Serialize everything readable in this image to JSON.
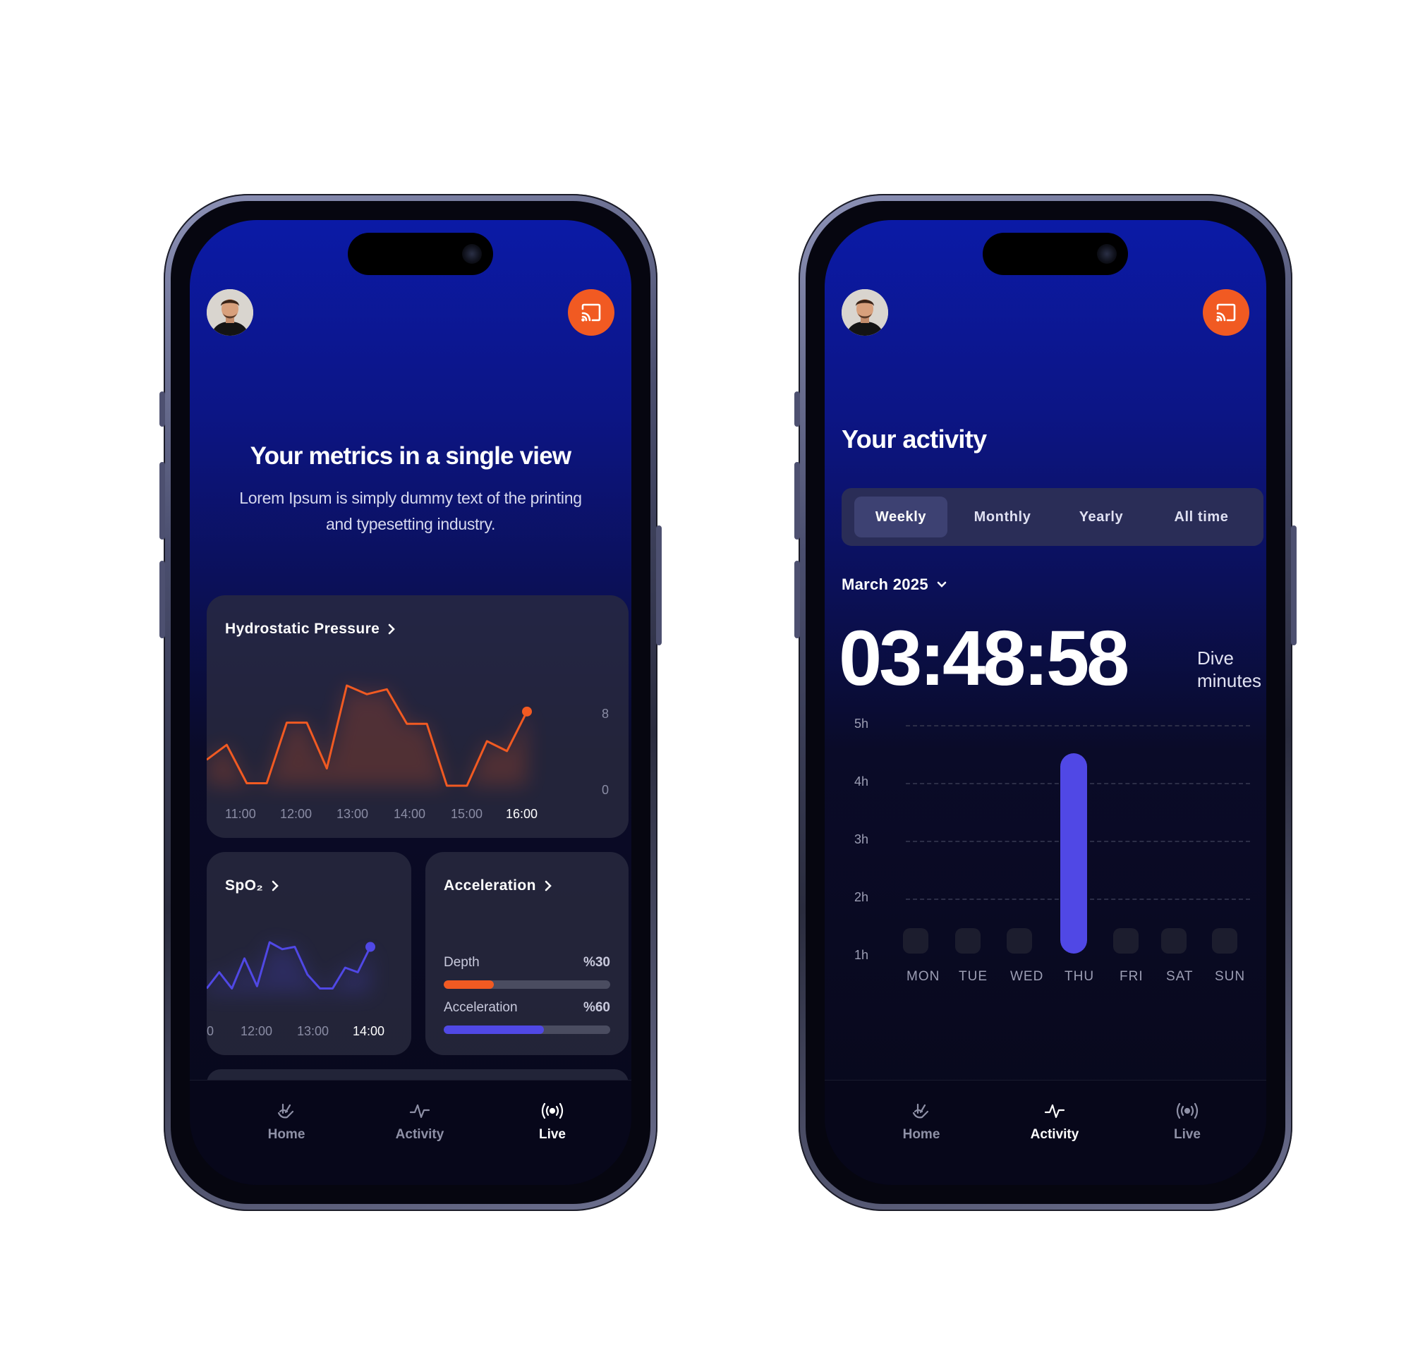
{
  "colors": {
    "accent_orange": "#f15a22",
    "accent_purple": "#5048e5",
    "screen_top": "#0b1aa6",
    "screen_bottom": "#08081a"
  },
  "phone1": {
    "hero": {
      "title": "Your metrics in a single view",
      "subtitle": "Lorem Ipsum is simply dummy text of the printing and typesetting industry."
    },
    "pressure_card": {
      "title": "Hydrostatic Pressure",
      "y_ticks": [
        "8",
        "0"
      ],
      "x_ticks": [
        "11:00",
        "12:00",
        "13:00",
        "14:00",
        "15:00",
        "16:00"
      ]
    },
    "spo2_card": {
      "title": "SpO₂",
      "x_ticks": [
        "0",
        "12:00",
        "13:00",
        "14:00"
      ]
    },
    "accel_card": {
      "title": "Acceleration",
      "rows": [
        {
          "label": "Depth",
          "value": "%30",
          "fraction": 0.3,
          "color": "#f15a22"
        },
        {
          "label": "Acceleration",
          "value": "%60",
          "fraction": 0.6,
          "color": "#5048e5"
        }
      ]
    },
    "nav": [
      {
        "label": "Home",
        "icon": "home-hand-icon",
        "active": false
      },
      {
        "label": "Activity",
        "icon": "activity-pulse-icon",
        "active": false
      },
      {
        "label": "Live",
        "icon": "live-broadcast-icon",
        "active": true
      }
    ]
  },
  "phone2": {
    "title": "Your activity",
    "tabs": [
      {
        "label": "Weekly",
        "active": true
      },
      {
        "label": "Monthly",
        "active": false
      },
      {
        "label": "Yearly",
        "active": false
      },
      {
        "label": "All time",
        "active": false
      }
    ],
    "month": "March 2025",
    "timer": "03:48:58",
    "timer_unit_line1": "Dive",
    "timer_unit_line2": "minutes",
    "nav": [
      {
        "label": "Home",
        "icon": "home-hand-icon",
        "active": false
      },
      {
        "label": "Activity",
        "icon": "activity-pulse-icon",
        "active": true
      },
      {
        "label": "Live",
        "icon": "live-broadcast-icon",
        "active": false
      }
    ]
  },
  "chart_data": [
    {
      "type": "line",
      "x_ticks": [
        "11:00",
        "12:00",
        "13:00",
        "14:00",
        "15:00",
        "16:00"
      ],
      "ylim": [
        0,
        8
      ],
      "y_ticks": [
        "0",
        "8"
      ],
      "series": [
        {
          "values": [
            2.1,
            3.3,
            0.2,
            0.2,
            5.1,
            5.1,
            1.4,
            8.1,
            7.4,
            7.8,
            5.0,
            5.0,
            0.0,
            0.0,
            3.6,
            2.8,
            6.0
          ]
        }
      ],
      "color": "#f15a22"
    },
    {
      "type": "line",
      "x_ticks": [
        "0",
        "12:00",
        "13:00",
        "14:00"
      ],
      "series": [
        {
          "values": [
            0.2,
            0.9,
            0.2,
            1.5,
            0.3,
            2.2,
            1.9,
            2.0,
            0.8,
            0.2,
            0.2,
            1.1,
            0.9,
            2.0
          ]
        }
      ],
      "color": "#5048e5"
    },
    {
      "type": "bar",
      "categories": [
        "MON",
        "TUE",
        "WED",
        "THU",
        "FRI",
        "SAT",
        "SUN"
      ],
      "values": [
        0.45,
        0.45,
        0.45,
        3.6,
        0.45,
        0.45,
        0.45
      ],
      "y_ticks": [
        "5h",
        "4h",
        "3h",
        "2h",
        "1h"
      ],
      "ylim": [
        0.9,
        5
      ],
      "highlight": "THU",
      "highlight_color": "#5048e5",
      "grid": "dashed"
    }
  ]
}
